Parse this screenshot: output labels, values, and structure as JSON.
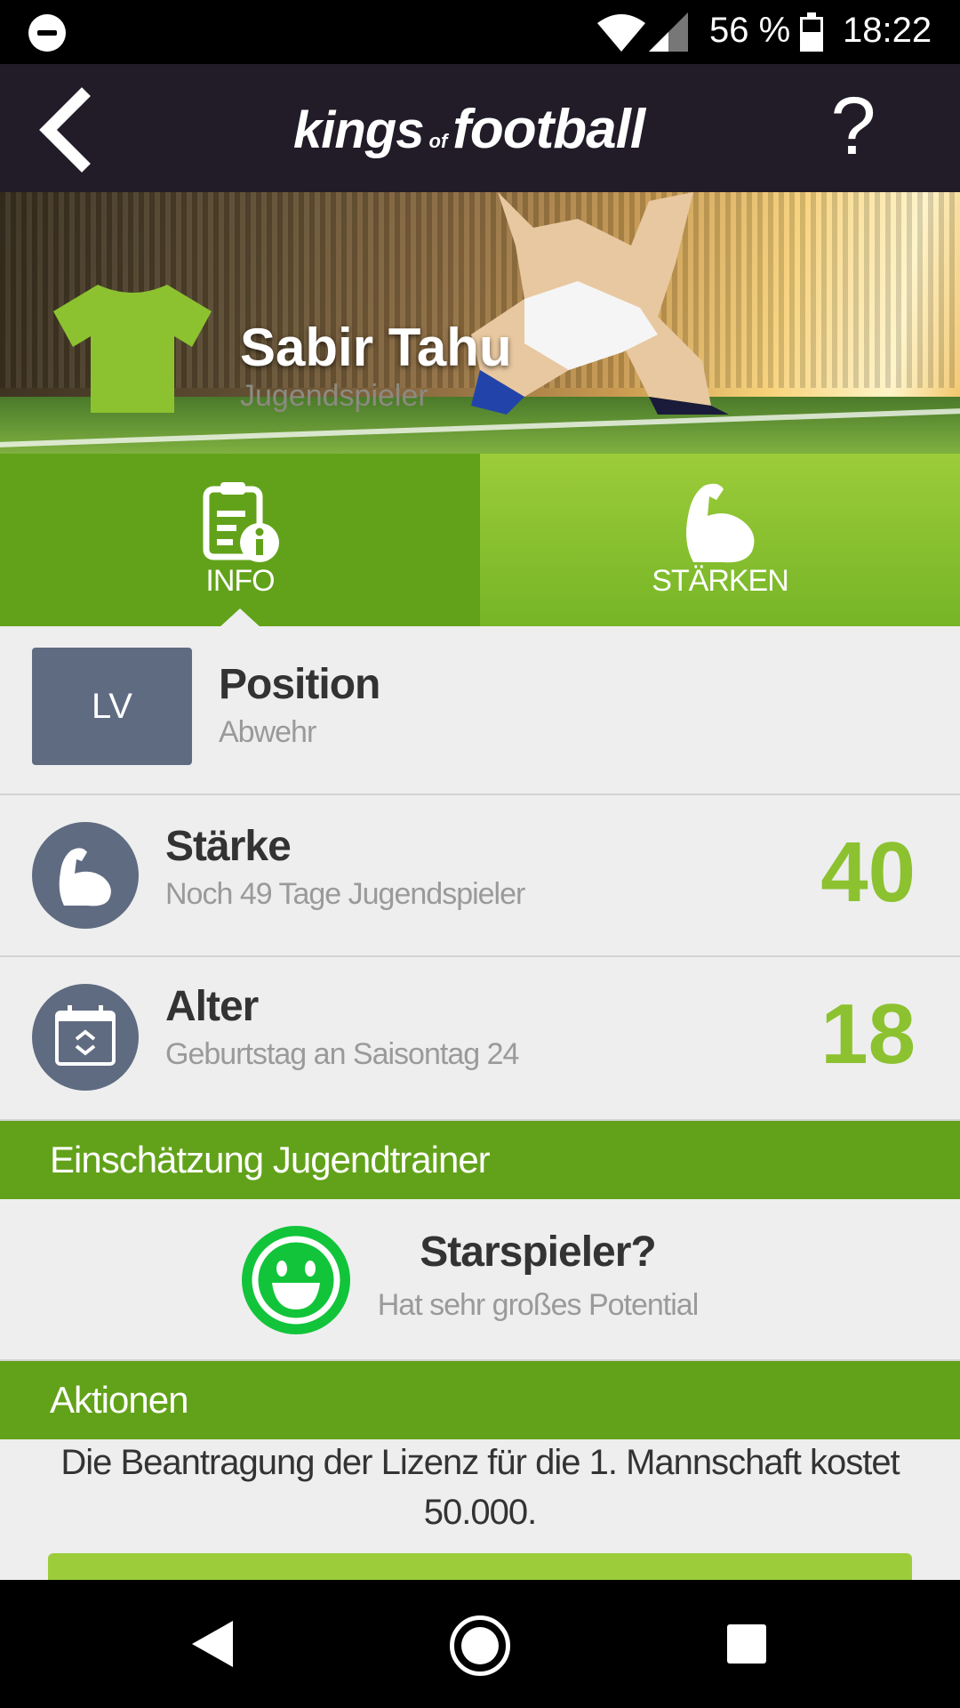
{
  "status_bar": {
    "battery": "56 %",
    "time": "18:22"
  },
  "header": {
    "logo_word1": "kings",
    "logo_of": "of",
    "logo_word2": "football",
    "help_label": "?"
  },
  "player": {
    "name": "Sabir Tahu",
    "role": "Jugendspieler"
  },
  "tabs": [
    {
      "label": "INFO",
      "selected": true
    },
    {
      "label": "STÄRKEN",
      "selected": false
    }
  ],
  "position": {
    "badge": "LV",
    "title": "Position",
    "value": "Abwehr"
  },
  "strength": {
    "title": "Stärke",
    "subtitle": "Noch 49 Tage Jugendspieler",
    "value": "40"
  },
  "age": {
    "title": "Alter",
    "subtitle": "Geburtstag an Saisontag 24",
    "value": "18"
  },
  "coach_assessment": {
    "header": "Einschätzung Jugendtrainer",
    "title": "Starspieler?",
    "subtitle": "Hat sehr großes Potential"
  },
  "actions": {
    "header": "Aktionen",
    "text": "Die Beantragung der Lizenz für die 1. Mannschaft kostet 50.000."
  },
  "colors": {
    "accent_green": "#62a21a",
    "value_green": "#8cc230",
    "header_dark": "#211c28",
    "badge_slate": "#5f6b80"
  }
}
